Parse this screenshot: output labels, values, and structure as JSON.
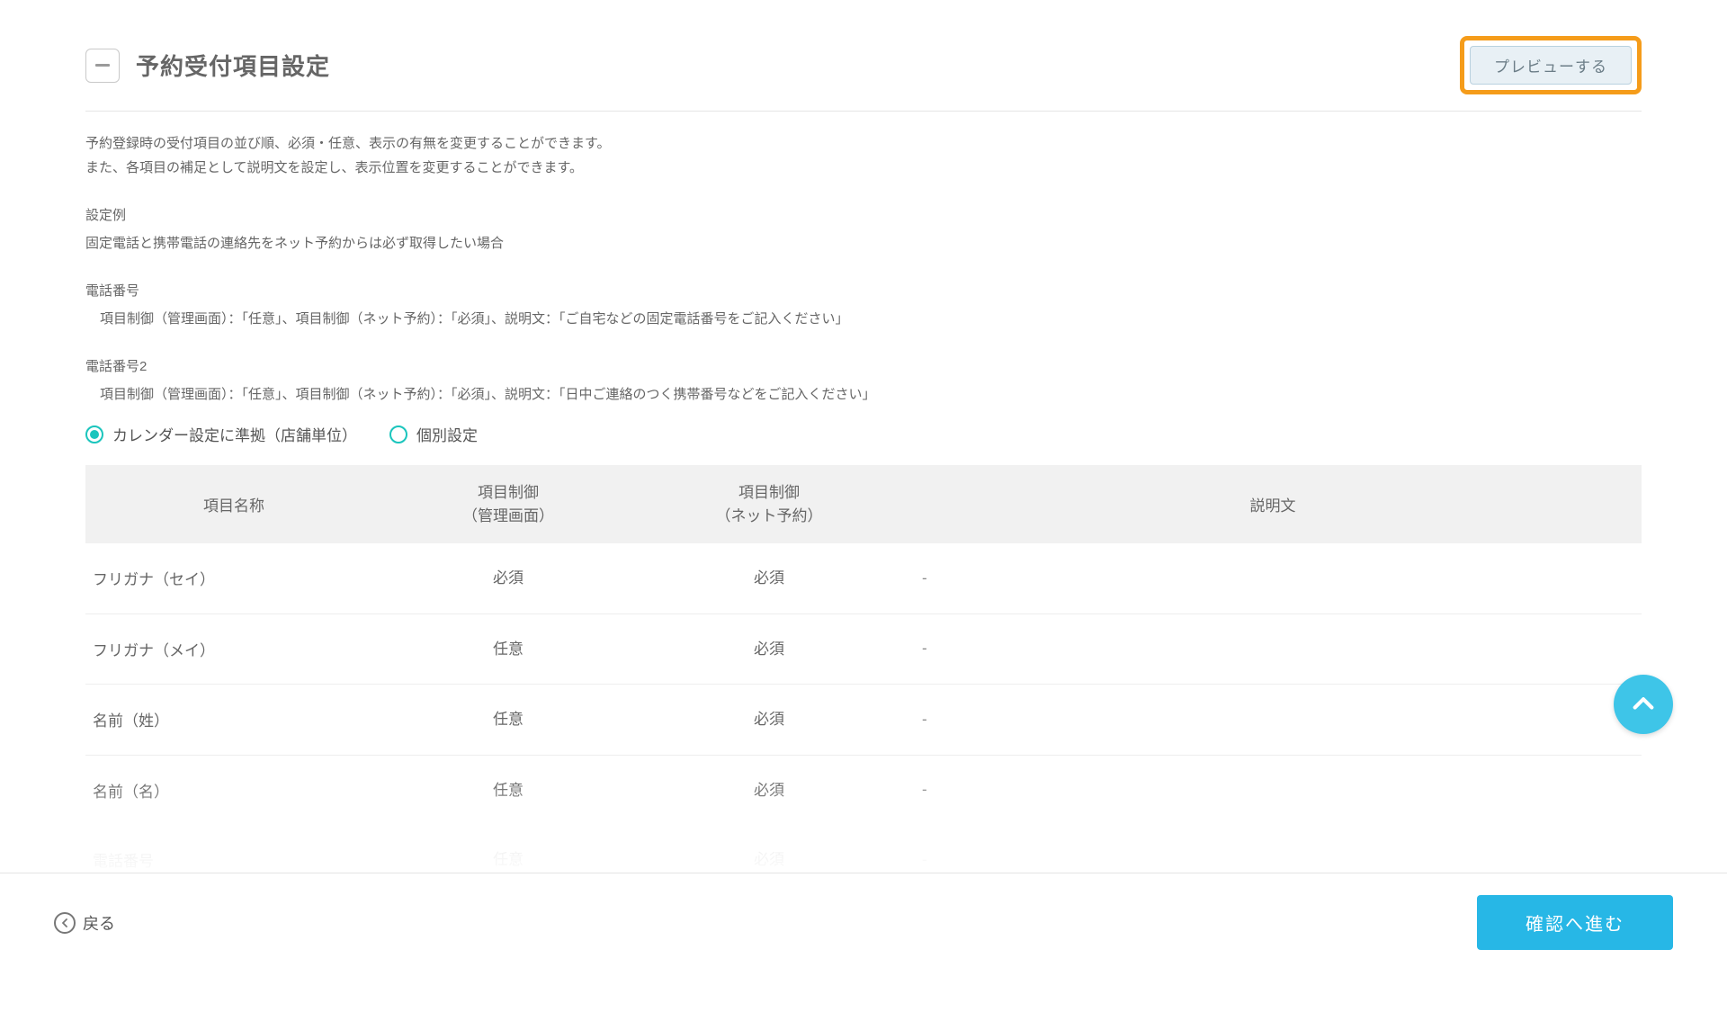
{
  "header": {
    "title": "予約受付項目設定",
    "preview_label": "プレビューする"
  },
  "intro": {
    "line1": "予約登録時の受付項目の並び順、必須・任意、表示の有無を変更することができます。",
    "line2": "また、各項目の補足として説明文を設定し、表示位置を変更することができます。",
    "example_heading": "設定例",
    "example_text": "固定電話と携帯電話の連絡先をネット予約からは必ず取得したい場合",
    "phone1_heading": "電話番号",
    "phone1_detail": "項目制御（管理画面）：「任意」、項目制御（ネット予約）：「必須」、説明文：「ご自宅などの固定電話番号をご記入ください」",
    "phone2_heading": "電話番号2",
    "phone2_detail": "項目制御（管理画面）：「任意」、項目制御（ネット予約）：「必須」、説明文：「日中ご連絡のつく携帯番号などをご記入ください」"
  },
  "radios": {
    "option1": "カレンダー設定に準拠（店舗単位）",
    "option2": "個別設定"
  },
  "table": {
    "headers": {
      "name": "項目名称",
      "control_admin_l1": "項目制御",
      "control_admin_l2": "（管理画面）",
      "control_net_l1": "項目制御",
      "control_net_l2": "（ネット予約）",
      "description": "説明文"
    },
    "rows": [
      {
        "name": "フリガナ（セイ）",
        "admin": "必須",
        "net": "必須",
        "desc": "-"
      },
      {
        "name": "フリガナ（メイ）",
        "admin": "任意",
        "net": "必須",
        "desc": "-"
      },
      {
        "name": "名前（姓）",
        "admin": "任意",
        "net": "必須",
        "desc": "-"
      },
      {
        "name": "名前（名）",
        "admin": "任意",
        "net": "必須",
        "desc": "-"
      },
      {
        "name": "電話番号",
        "admin": "任意",
        "net": "必須",
        "desc": "-"
      }
    ]
  },
  "footer": {
    "back": "戻る",
    "confirm": "確認へ進む"
  }
}
